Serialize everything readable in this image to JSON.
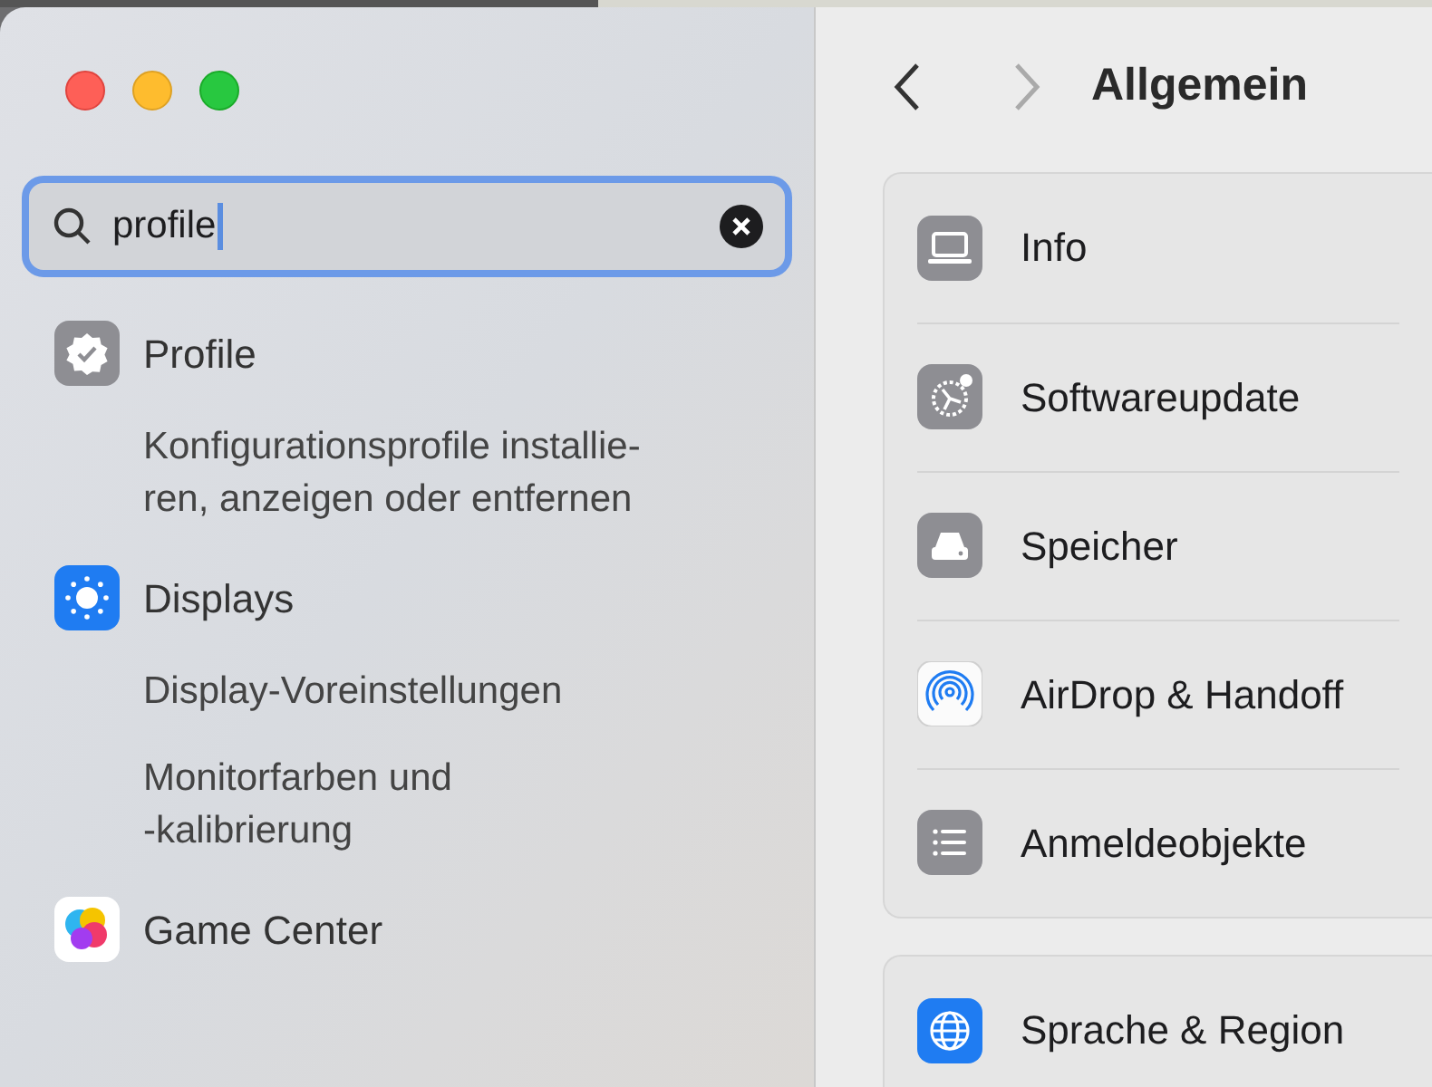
{
  "search": {
    "value": "profile"
  },
  "results": [
    {
      "kind": "section",
      "label": "Profile"
    },
    {
      "kind": "result",
      "label": "Konfigurationsprofile installie-\nren, anzeigen oder entfernen"
    },
    {
      "kind": "section",
      "label": "Displays"
    },
    {
      "kind": "result",
      "label": "Display-Voreinstellungen"
    },
    {
      "kind": "result",
      "label": "Monitorfarben und\n-kalibrierung"
    },
    {
      "kind": "section",
      "label": "Game Center"
    }
  ],
  "header": {
    "title": "Allgemein"
  },
  "groups": [
    [
      {
        "label": "Info"
      },
      {
        "label": "Softwareupdate"
      },
      {
        "label": "Speicher"
      },
      {
        "label": "AirDrop & Handoff"
      },
      {
        "label": "Anmeldeobjekte"
      }
    ],
    [
      {
        "label": "Sprache & Region"
      }
    ]
  ]
}
